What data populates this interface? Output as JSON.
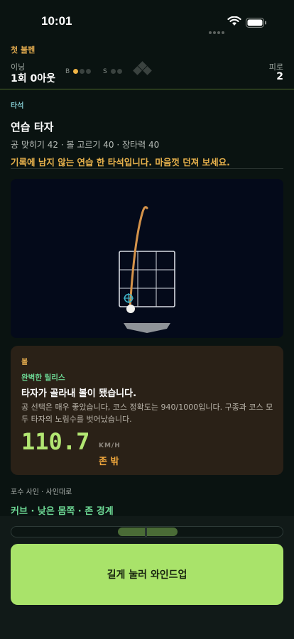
{
  "status": {
    "time": "10:01"
  },
  "scoreboard": {
    "title": "첫 불펜",
    "inning_label": "이닝",
    "inning_value": "1회 0아웃",
    "balls_label": "B",
    "strikes_label": "S",
    "balls": 1,
    "strikes": 0,
    "fatigue_label": "피로",
    "fatigue_value": "2"
  },
  "batter": {
    "section_label": "타석",
    "name": "연습 타자",
    "stats": "공 맞히기 42 · 볼 고르기 40 · 장타력 40",
    "note": "기록에 남지 않는 연습 한 타석입니다. 마음껏 던져 보세요."
  },
  "ball": {
    "label": "볼",
    "quality": "완벽한 릴리스",
    "headline": "타자가 골라내 볼이 됐습니다.",
    "description": "공 선택은 매우 좋았습니다, 코스 정확도는 940/1000입니다. 구종과 코스 모두 타자의 노림수를 벗어났습니다.",
    "speed": "110.7",
    "speed_unit": "KM/H",
    "result": "존 밖"
  },
  "catcher": {
    "label": "포수 사인 · 사인대로",
    "call": "커브 · 낮은 몸쪽 · 존 경계"
  },
  "action": {
    "windup_label": "길게 눌러 와인드업"
  },
  "colors": {
    "accent_green": "#a9e36a",
    "accent_orange": "#e0a94e",
    "background": "#0a1311"
  }
}
